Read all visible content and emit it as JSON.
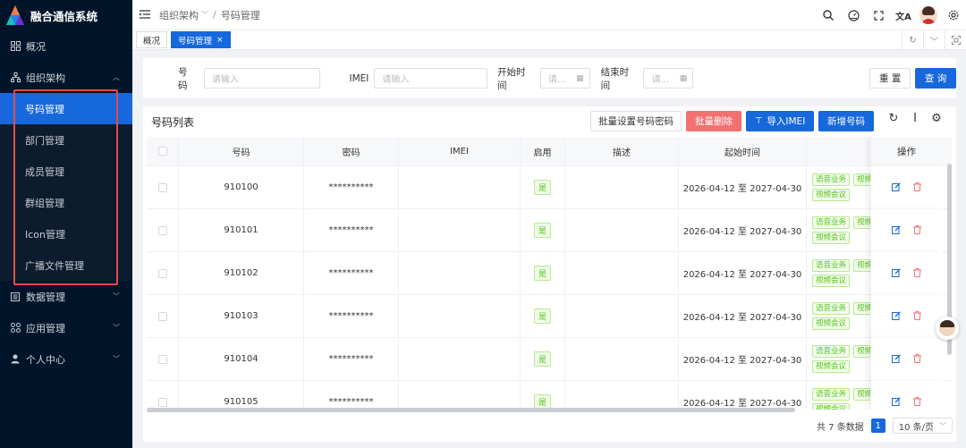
{
  "app": {
    "title": "融合通信系统"
  },
  "sidebar": {
    "items": [
      {
        "label": "概况",
        "icon": "dashboard-icon"
      },
      {
        "label": "组织架构",
        "icon": "org-icon",
        "expanded": true
      },
      {
        "label": "数据管理",
        "icon": "data-icon"
      },
      {
        "label": "应用管理",
        "icon": "apps-icon"
      },
      {
        "label": "个人中心",
        "icon": "user-icon"
      }
    ],
    "submenu": [
      {
        "label": "号码管理",
        "active": true
      },
      {
        "label": "部门管理"
      },
      {
        "label": "成员管理"
      },
      {
        "label": "群组管理"
      },
      {
        "label": "Icon管理"
      },
      {
        "label": "广播文件管理"
      }
    ]
  },
  "header": {
    "breadcrumb": [
      "组织架构",
      "号码管理"
    ],
    "icons": [
      "search-icon",
      "dashboard-meter-icon",
      "fullscreen-icon",
      "translate-icon",
      "avatar",
      "settings-icon"
    ]
  },
  "tabs": [
    {
      "label": "概况",
      "active": false
    },
    {
      "label": "号码管理",
      "active": true
    }
  ],
  "search": {
    "number_label": "号码",
    "number_placeholder": "请输入",
    "imei_label": "IMEI",
    "imei_placeholder": "请输入",
    "start_label": "开始时间",
    "start_placeholder": "请...",
    "end_label": "结束时间",
    "end_placeholder": "请...",
    "reset": "重 置",
    "query": "查 询"
  },
  "table": {
    "title": "号码列表",
    "actions": {
      "batch_password": "批量设置号码密码",
      "batch_delete": "批量删除",
      "import_imei": "导入IMEI",
      "add_number": "新增号码"
    },
    "columns": [
      "号码",
      "密码",
      "IMEI",
      "启用",
      "描述",
      "起始时间",
      "",
      "操作"
    ],
    "rows": [
      {
        "number": "910100",
        "password": "**********",
        "imei": "",
        "enabled": "是",
        "desc": "",
        "period": "2026-04-12 至 2027-04-30",
        "biz": [
          "语音业务",
          "视频",
          "视频会议"
        ]
      },
      {
        "number": "910101",
        "password": "**********",
        "imei": "",
        "enabled": "是",
        "desc": "",
        "period": "2026-04-12 至 2027-04-30",
        "biz": [
          "语音业务",
          "视频",
          "视频会议"
        ]
      },
      {
        "number": "910102",
        "password": "**********",
        "imei": "",
        "enabled": "是",
        "desc": "",
        "period": "2026-04-12 至 2027-04-30",
        "biz": [
          "语音业务",
          "视频",
          "视频会议"
        ]
      },
      {
        "number": "910103",
        "password": "**********",
        "imei": "",
        "enabled": "是",
        "desc": "",
        "period": "2026-04-12 至 2027-04-30",
        "biz": [
          "语音业务",
          "视频",
          "视频会议"
        ]
      },
      {
        "number": "910104",
        "password": "**********",
        "imei": "",
        "enabled": "是",
        "desc": "",
        "period": "2026-04-12 至 2027-04-30",
        "biz": [
          "语音业务",
          "视频",
          "视频会议"
        ]
      },
      {
        "number": "910105",
        "password": "**********",
        "imei": "",
        "enabled": "是",
        "desc": "",
        "period": "2026-04-12 至 2027-04-30",
        "biz": [
          "语音业务",
          "视频",
          "视频会议"
        ]
      }
    ]
  },
  "pagination": {
    "total_text": "共 7 条数据",
    "current_page": "1",
    "page_size": "10 条/页"
  },
  "colors": {
    "sidebar_bg": "#001529",
    "primary": "#1668dc",
    "danger": "#f17171",
    "tag_green": "#52c41a",
    "highlight_box": "#e54b4b"
  }
}
